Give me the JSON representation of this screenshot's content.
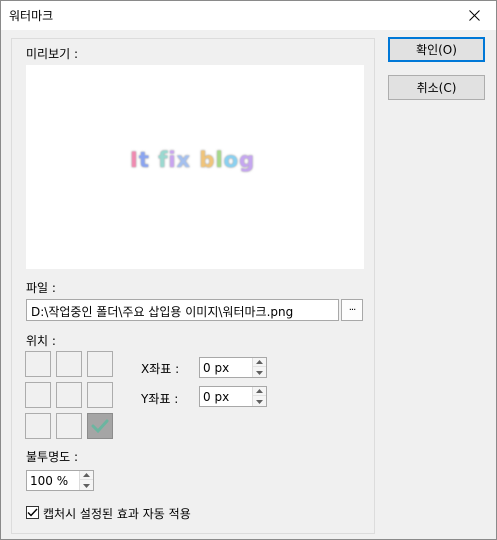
{
  "window": {
    "title": "워터마크"
  },
  "preview": {
    "label": "미리보기 :",
    "watermark_text": [
      "I",
      "t",
      " ",
      "f",
      "i",
      "x",
      " ",
      "b",
      "l",
      "o",
      "g"
    ],
    "watermark_colors": [
      "#f08ab0",
      "#8aa4f0",
      "#ffffff",
      "#9ad9d0",
      "#c9a4f0",
      "#a4c0f0",
      "#ffffff",
      "#f0c47a",
      "#a6d98a",
      "#8ad0f0",
      "#c5a6f0"
    ]
  },
  "file": {
    "label": "파일 :",
    "path": "D:\\작업중인 폴더\\주요 삽입용 이미지\\워터마크.png",
    "browse_label": "···"
  },
  "position": {
    "label": "위치 :",
    "selected_index": 8,
    "x_label": "X좌표 :",
    "x_value": "0 px",
    "y_label": "Y좌표 :",
    "y_value": "0 px"
  },
  "opacity": {
    "label": "불투명도 :",
    "value": "100 %"
  },
  "auto_apply": {
    "label": "캡처시 설정된 효과 자동 적용",
    "checked": true
  },
  "buttons": {
    "ok": "확인(O)",
    "cancel": "취소(C)"
  }
}
